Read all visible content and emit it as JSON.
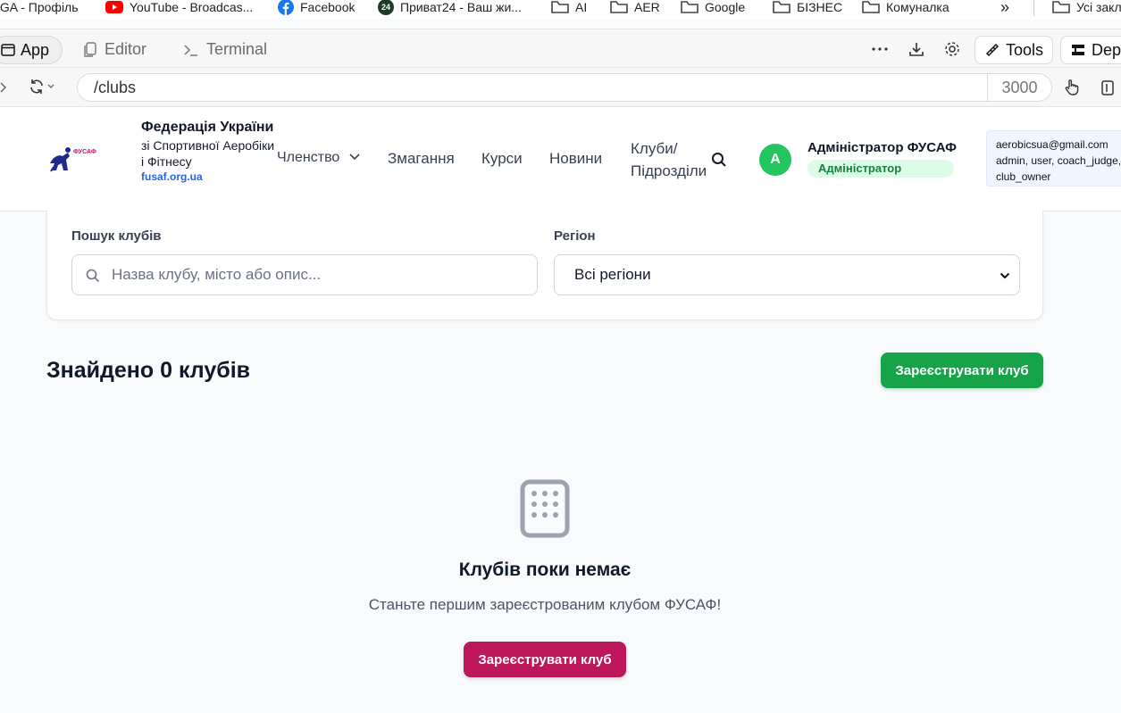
{
  "bookmarks": {
    "items": [
      {
        "label": "IGA - Профіль",
        "icon": "none"
      },
      {
        "label": "YouTube - Broadcas...",
        "icon": "youtube-icon"
      },
      {
        "label": "Facebook",
        "icon": "facebook-icon"
      },
      {
        "label": "Приват24 - Ваш жи...",
        "icon": "privat24-icon",
        "badge": "24"
      },
      {
        "label": "AI",
        "icon": "folder-icon"
      },
      {
        "label": "AER",
        "icon": "folder-icon"
      },
      {
        "label": "Google",
        "icon": "folder-icon"
      },
      {
        "label": "БІЗНЕС",
        "icon": "folder-icon"
      },
      {
        "label": "Комуналка",
        "icon": "folder-icon"
      }
    ],
    "overflow": "»",
    "all_bookmarks": "Усі закл"
  },
  "toolbar": {
    "app_label": "App",
    "editor_label": "Editor",
    "terminal_label": "Terminal",
    "tools_label": "Tools",
    "deploy_label": "Dep"
  },
  "address": {
    "url": "/clubs",
    "port": "3000"
  },
  "site": {
    "logo_text": "ФУСАФ",
    "org_name": "Федерація України",
    "org_sub": "зі Спортивної Аеробіки і Фітнесу",
    "org_url": "fusaf.org.ua",
    "nav": {
      "membership": "Членство",
      "competitions": "Змагання",
      "courses": "Курси",
      "news": "Новини",
      "clubs": "Клуби/ Підрозділи"
    },
    "user": {
      "avatar_letter": "A",
      "name": "Адміністратор ФУСАФ",
      "role": "Адміністратор"
    },
    "debug": {
      "email": "aerobicsua@gmail.com",
      "roles_line1": "admin, user, coach_judge,",
      "roles_line2": "club_owner"
    }
  },
  "filters": {
    "search_label": "Пошук клубів",
    "search_placeholder": "Назва клубу, місто або опис...",
    "region_label": "Регіон",
    "region_value": "Всі регіони"
  },
  "results": {
    "found_text": "Знайдено 0 клубів",
    "register_button": "Зареєструвати клуб",
    "empty_title": "Клубів поки немає",
    "empty_desc": "Станьте першим зареєстрованим клубом ФУСАФ!",
    "empty_button": "Зареєструвати клуб"
  },
  "colors": {
    "green": "#16a34a",
    "pink": "#be185d",
    "blue_link": "#2563eb",
    "avatar_green": "#22c55e"
  }
}
